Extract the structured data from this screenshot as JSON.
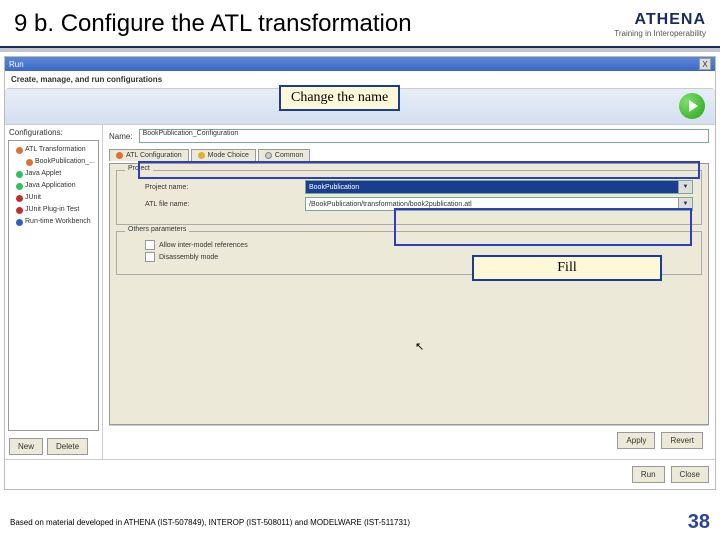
{
  "header": {
    "title": "9 b. Configure the ATL transformation",
    "logo_main": "ATHENA",
    "logo_sub": "Training in Interoperability"
  },
  "callouts": {
    "change_name": "Change the name",
    "fill": "Fill"
  },
  "dialog": {
    "title": "Run",
    "close": "X",
    "subtitle": "Create, manage, and run configurations",
    "left_label": "Configurations:",
    "tree": [
      {
        "color": "#e07030",
        "label": "ATL Transformation",
        "child": false
      },
      {
        "color": "#e07030",
        "label": "BookPublication_...",
        "child": true
      },
      {
        "color": "#30c060",
        "label": "Java Applet",
        "child": false
      },
      {
        "color": "#30c060",
        "label": "Java Application",
        "child": false
      },
      {
        "color": "#c03030",
        "label": "JUnit",
        "child": false
      },
      {
        "color": "#c03030",
        "label": "JUnit Plug-in Test",
        "child": false
      },
      {
        "color": "#3060c0",
        "label": "Run-time Workbench",
        "child": false
      }
    ],
    "new_btn": "New",
    "delete_btn": "Delete",
    "name_label": "Name:",
    "name_value": "BookPublication_Configuration",
    "tabs": [
      {
        "color": "#e07030",
        "label": "ATL Configuration"
      },
      {
        "color": "#e0b030",
        "label": "Mode Choice"
      },
      {
        "color": "#cccccc",
        "label": "Common"
      }
    ],
    "group_project": "Project",
    "project_label": "Project name:",
    "project_value": "BookPublication",
    "atlfile_label": "ATL file name:",
    "atlfile_value": "/BookPublication/transformation/book2publication.atl",
    "group_params": "Others parameters",
    "chk_intermodel": "Allow inter-model references",
    "chk_disassembly": "Disassembly mode",
    "apply_btn": "Apply",
    "revert_btn": "Revert",
    "run_btn": "Run",
    "close_btn": "Close"
  },
  "footer": {
    "text": "Based on material developed in ATHENA (IST-507849), INTEROP (IST-508011) and MODELWARE (IST-511731)",
    "page": "38"
  }
}
